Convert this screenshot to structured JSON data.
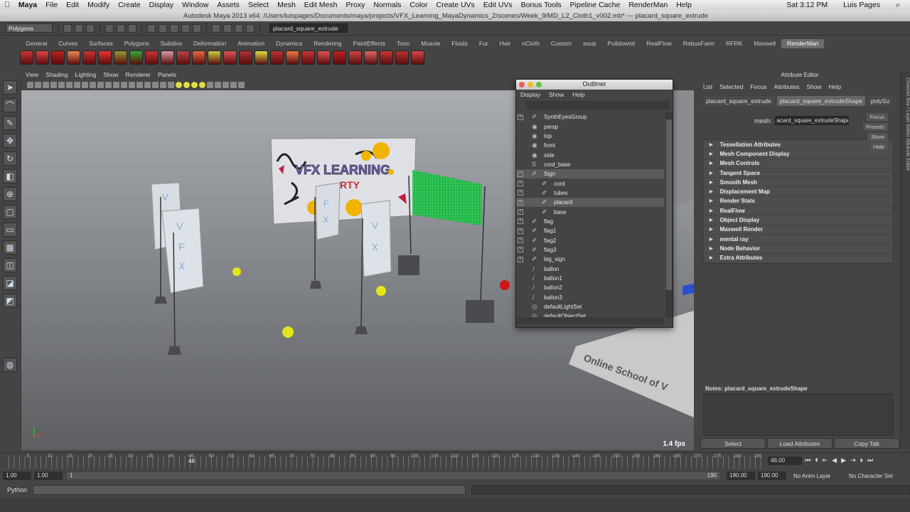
{
  "menubar": {
    "apple": "",
    "app": "Maya",
    "items": [
      "File",
      "Edit",
      "Modify",
      "Create",
      "Display",
      "Window",
      "Assets",
      "Select",
      "Mesh",
      "Edit Mesh",
      "Proxy",
      "Normals",
      "Color",
      "Create UVs",
      "Edit UVs",
      "Bonus Tools",
      "Pipeline Cache",
      "RenderMan",
      "Help"
    ],
    "clock": "Sat 3:12 PM",
    "user": "Luis Pages"
  },
  "titlebar": "Autodesk Maya 2013 x64: /Users/luispages/Documents/maya/projects/VFX_Learning_MayaDynamics_2/scenes/Week_9/MD_L2_Cloth1_v002.mb*   ---   placard_square_extrude",
  "statusline": {
    "menuset": "Polygons",
    "selection_field": "placard_square_extrude"
  },
  "shelf": {
    "tabs": [
      "General",
      "Curves",
      "Surfaces",
      "Polygons",
      "Subdivs",
      "Deformation",
      "Animation",
      "Dynamics",
      "Rendering",
      "PaintEffects",
      "Toon",
      "Muscle",
      "Fluids",
      "Fur",
      "Hair",
      "nCloth",
      "Custom",
      "soup",
      "Pulldownit",
      "RealFlow",
      "RebusFarm",
      "RFRK",
      "Maxwell",
      "RenderMan"
    ],
    "active_tab": "RenderMan",
    "icon_count": 26
  },
  "panel": {
    "menus": [
      "View",
      "Shading",
      "Lighting",
      "Show",
      "Renderer",
      "Panels"
    ],
    "fps": "1.4 fps"
  },
  "outliner": {
    "title": "Outliner",
    "menus": [
      "Display",
      "Show",
      "Help"
    ],
    "rows": [
      {
        "label": "SynthEyesGroup",
        "exp": "+",
        "icon": "mesh"
      },
      {
        "label": "persp",
        "exp": "",
        "icon": "camera"
      },
      {
        "label": "top",
        "exp": "",
        "icon": "camera"
      },
      {
        "label": "front",
        "exp": "",
        "icon": "camera"
      },
      {
        "label": "side",
        "exp": "",
        "icon": "camera"
      },
      {
        "label": "cord_base",
        "exp": "",
        "icon": "curve"
      },
      {
        "label": "Sign",
        "exp": "-",
        "icon": "mesh",
        "sel": true
      },
      {
        "label": "cord",
        "exp": "+",
        "icon": "mesh",
        "indent": 1
      },
      {
        "label": "tubes",
        "exp": "+",
        "icon": "mesh",
        "indent": 1
      },
      {
        "label": "placard",
        "exp": "+",
        "icon": "mesh",
        "indent": 1,
        "sel": true
      },
      {
        "label": "base",
        "exp": "+",
        "icon": "mesh",
        "indent": 1
      },
      {
        "label": "flag",
        "exp": "+",
        "icon": "mesh"
      },
      {
        "label": "flag1",
        "exp": "+",
        "icon": "mesh"
      },
      {
        "label": "flag2",
        "exp": "+",
        "icon": "mesh"
      },
      {
        "label": "flag3",
        "exp": "+",
        "icon": "mesh"
      },
      {
        "label": "big_sign",
        "exp": "+",
        "icon": "mesh"
      },
      {
        "label": "ballon",
        "exp": "",
        "icon": "field"
      },
      {
        "label": "ballon1",
        "exp": "",
        "icon": "field"
      },
      {
        "label": "ballon2",
        "exp": "",
        "icon": "field"
      },
      {
        "label": "ballon3",
        "exp": "",
        "icon": "field"
      },
      {
        "label": "defaultLightSet",
        "exp": "",
        "icon": "set"
      },
      {
        "label": "defaultObjectSet",
        "exp": "",
        "icon": "set"
      }
    ]
  },
  "attribute_editor": {
    "title": "Attribute Editor",
    "menus": [
      "List",
      "Selected",
      "Focus",
      "Attributes",
      "Show",
      "Help"
    ],
    "tabs": [
      "placard_square_extrude",
      "placard_square_extrudeShape",
      "polySu"
    ],
    "active_tab": "placard_square_extrudeShape",
    "mesh_label": "mesh:",
    "mesh_value": "acard_square_extrudeShape",
    "side_buttons": [
      "Focus",
      "Presets",
      "Show",
      "Hide"
    ],
    "sections": [
      "Tessellation Attributes",
      "Mesh Component Display",
      "Mesh Controls",
      "Tangent Space",
      "Smooth Mesh",
      "Displacement Map",
      "Render Stats",
      "RealFlow",
      "Object Display",
      "Maxwell Render",
      "mental ray",
      "Node Behavior",
      "Extra Attributes"
    ],
    "notes_label": "Notes:  placard_square_extrudeShape",
    "buttons": [
      "Select",
      "Load Attributes",
      "Copy Tab"
    ]
  },
  "side_strip": "Channel Box / Layer Editor   Attribute Editor",
  "timeline": {
    "current_frame": "46",
    "frame_field": "46.00",
    "ticks": [
      "5",
      "10",
      "15",
      "20",
      "25",
      "30",
      "35",
      "40",
      "45",
      "50",
      "55",
      "60",
      "65",
      "70",
      "75",
      "80",
      "85",
      "90",
      "95",
      "100",
      "105",
      "110",
      "115",
      "120",
      "125",
      "130",
      "135",
      "140",
      "145",
      "150",
      "155",
      "160",
      "165",
      "170",
      "175",
      "180",
      "185"
    ]
  },
  "range": {
    "start": "1.00",
    "anim_start": "1.00",
    "marker": "1",
    "marker_end": "190",
    "anim_end": "190.00",
    "end": "190.00",
    "anim_layer": "No Anim Layer",
    "char_set": "No Character Set"
  },
  "cmdline": {
    "label": "Python"
  }
}
